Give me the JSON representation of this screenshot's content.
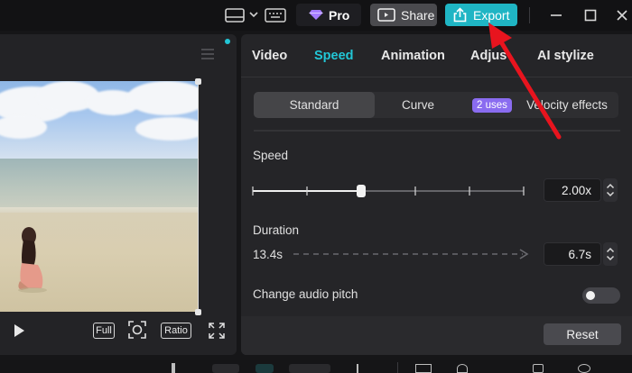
{
  "header": {
    "pro_label": "Pro",
    "share_label": "Share",
    "export_label": "Export"
  },
  "player": {
    "controls": {
      "full_label": "Full",
      "ratio_label": "Ratio"
    }
  },
  "props": {
    "tabs": [
      {
        "label": "Video",
        "active": false
      },
      {
        "label": "Speed",
        "active": true
      },
      {
        "label": "Animation",
        "active": false
      },
      {
        "label": "Adjus",
        "active": false
      },
      {
        "label": "AI stylize",
        "active": false
      }
    ],
    "modes": {
      "standard": "Standard",
      "curve": "Curve",
      "uses_badge": "2 uses",
      "velocity": "Velocity effects"
    },
    "speed": {
      "label": "Speed",
      "value": "2.00x",
      "slider_fraction": 0.4
    },
    "duration": {
      "label": "Duration",
      "original": "13.4s",
      "value": "6.7s"
    },
    "audio_pitch": {
      "label": "Change audio pitch",
      "enabled": false
    },
    "reset_label": "Reset"
  },
  "colors": {
    "accent": "#22c6d6",
    "export": "#1fb5c4",
    "badge": "#8a6cf0",
    "annotation_arrow": "#e8141e"
  },
  "icons": [
    "layout-icon",
    "chevron-down-icon",
    "keyboard-icon",
    "diamond-icon",
    "share-screen-icon",
    "export-upload-icon",
    "minimize-icon",
    "maximize-icon",
    "close-icon",
    "menu-icon",
    "play-icon",
    "focus-icon",
    "fullscreen-icon"
  ]
}
